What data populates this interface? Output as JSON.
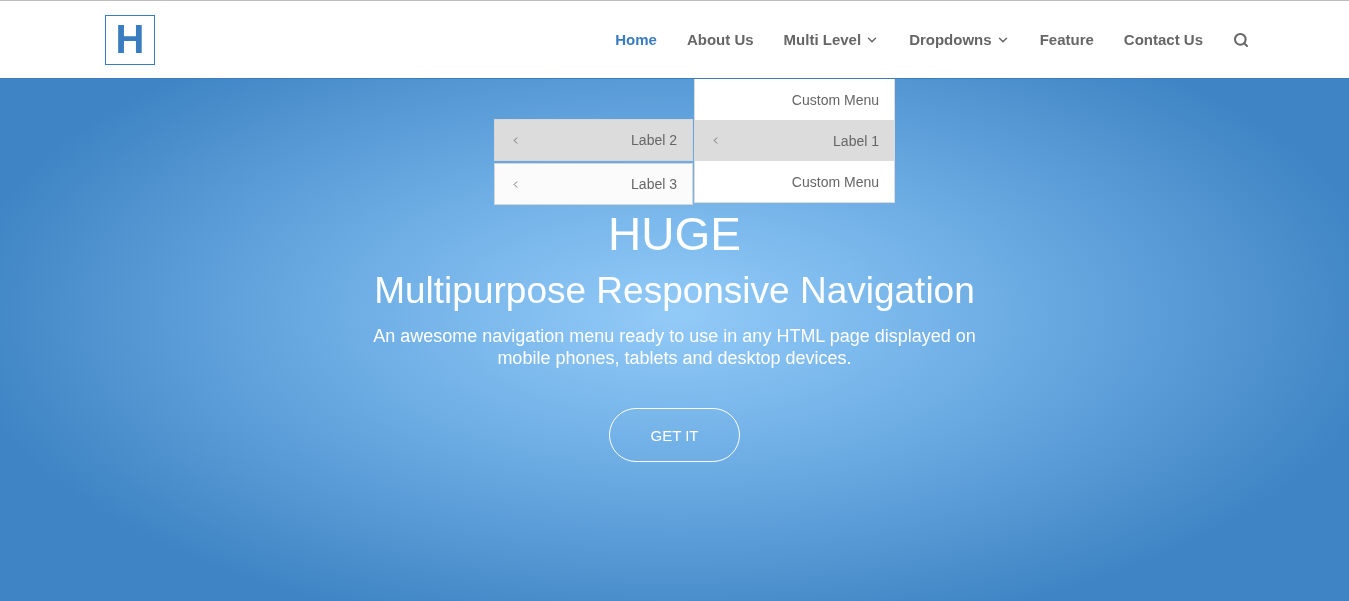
{
  "logo": {
    "letter": "H"
  },
  "nav": [
    {
      "label": "Home",
      "selected": true,
      "dropdown": false
    },
    {
      "label": "About Us",
      "selected": false,
      "dropdown": false
    },
    {
      "label": "Multi Level",
      "selected": false,
      "dropdown": true,
      "menu": [
        {
          "label": "Custom Menu",
          "kind": "link",
          "selected": false
        },
        {
          "label": "Label 1",
          "kind": "submenu",
          "selected": true,
          "children": [
            {
              "label": "Label 2",
              "kind": "submenu",
              "selected": true
            },
            {
              "label": "Label 3",
              "kind": "submenu",
              "selected": false
            }
          ]
        },
        {
          "label": "Custom Menu",
          "kind": "link",
          "selected": false
        }
      ]
    },
    {
      "label": "Dropdowns",
      "selected": false,
      "dropdown": true
    },
    {
      "label": "Feature",
      "selected": false,
      "dropdown": false
    },
    {
      "label": "Contact Us",
      "selected": false,
      "dropdown": false
    }
  ],
  "hero": {
    "title": "HUGE",
    "subtitle": "Multipurpose Responsive Navigation",
    "description": "An awesome navigation menu ready to use in any HTML page displayed on mobile phones, tablets and desktop devices.",
    "button": "GET IT"
  }
}
